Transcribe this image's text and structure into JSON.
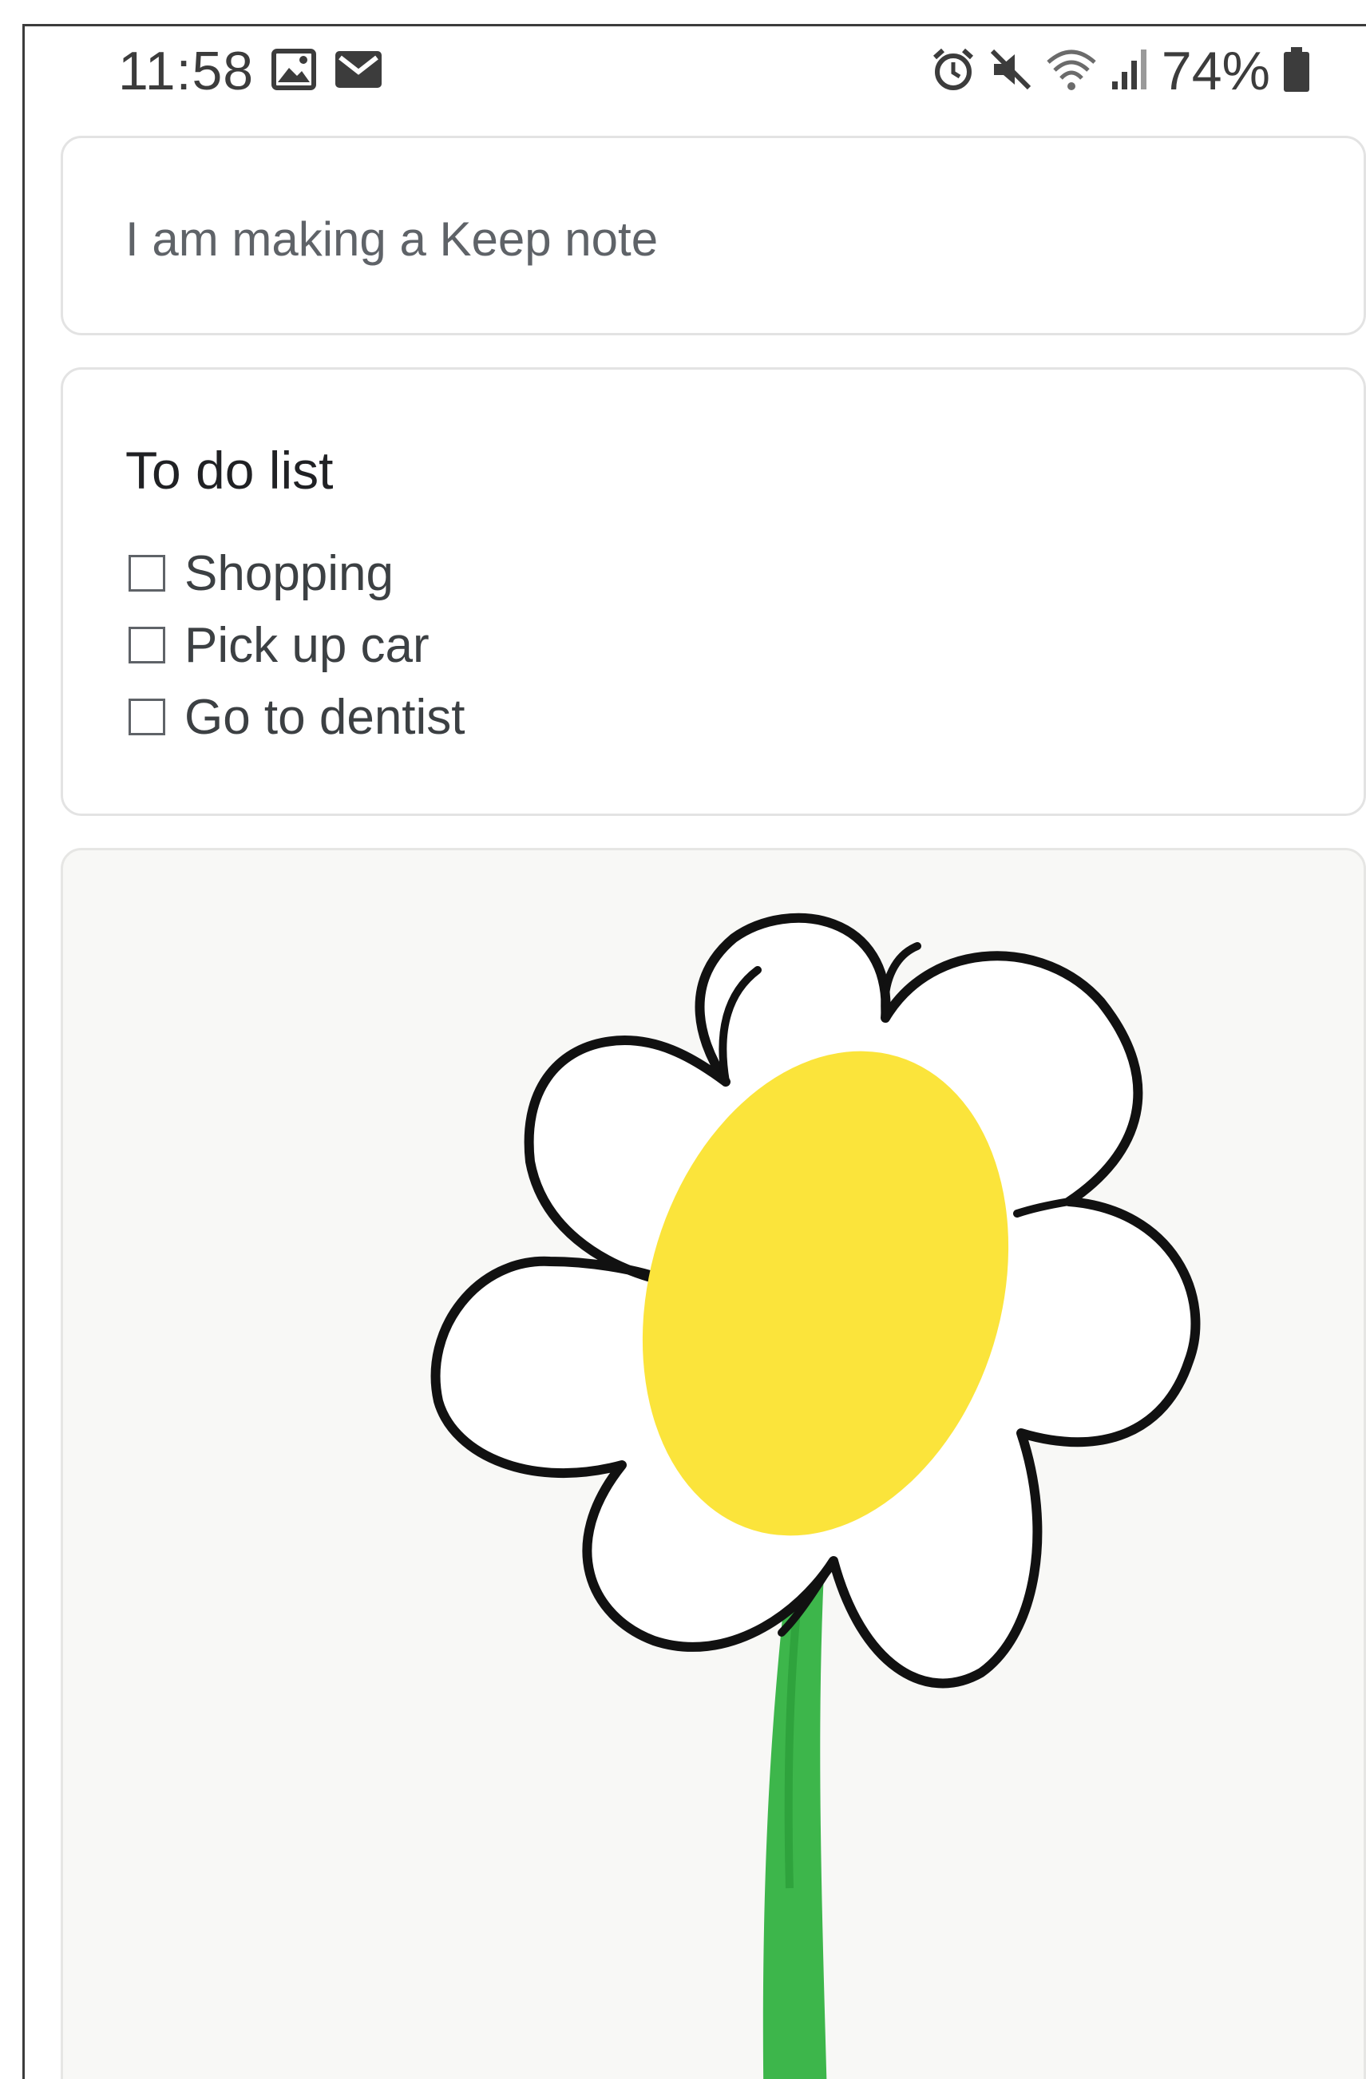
{
  "status_bar": {
    "time": "11:58",
    "battery": "74%",
    "left_icons": [
      "image-icon",
      "mail-icon"
    ],
    "right_icons": [
      "alarm-icon",
      "mute-icon",
      "wifi-icon",
      "signal-icon",
      "battery-icon"
    ]
  },
  "notes": {
    "text_note": {
      "body": "I am making a Keep note"
    },
    "todo_note": {
      "title": "To do list",
      "items": [
        {
          "label": "Shopping",
          "checked": false
        },
        {
          "label": "Pick up car",
          "checked": false
        },
        {
          "label": "Go to dentist",
          "checked": false
        }
      ]
    },
    "drawing_note": {
      "subject": "flower-drawing",
      "colors": {
        "center": "#fbe43b",
        "stem": "#3db64b",
        "outline": "#111111",
        "background": "#f8f8f6"
      }
    }
  }
}
